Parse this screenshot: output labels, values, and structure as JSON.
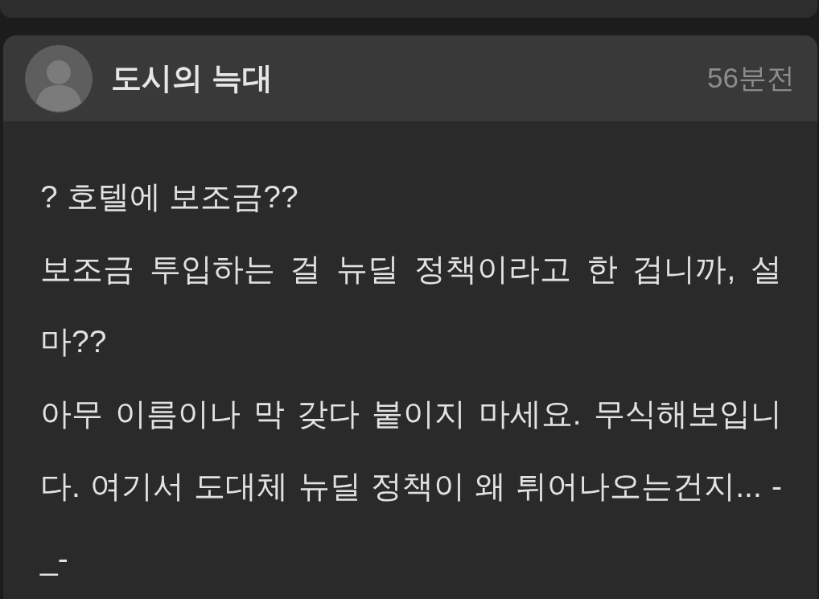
{
  "post": {
    "author": {
      "name": "도시의 늑대"
    },
    "time": "56분전",
    "paragraphs": [
      "? 호텔에 보조금??",
      "보조금 투입하는 걸 뉴딜 정책이라고 한 겁니까, 설마??",
      "아무 이름이나 막 갖다 붙이지 마세요. 무식해보입니다. 여기서 도대체 뉴딜 정책이 왜 튀어나오는건지... -_-"
    ]
  }
}
